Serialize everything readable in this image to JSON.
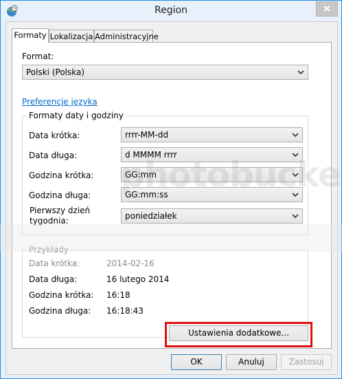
{
  "window": {
    "title": "Region"
  },
  "tabs": [
    {
      "label": "Formaty"
    },
    {
      "label": "Lokalizacja"
    },
    {
      "label": "Administracyjne"
    }
  ],
  "format": {
    "label": "Format:",
    "value": "Polski (Polska)"
  },
  "language_link": "Preferencje języka",
  "datetime_group": {
    "title": "Formaty daty i godziny",
    "rows": [
      {
        "label": "Data krótka:",
        "value": "rrrr-MM-dd"
      },
      {
        "label": "Data długa:",
        "value": "d MMMM rrrr"
      },
      {
        "label": "Godzina krótka:",
        "value": "GG:mm"
      },
      {
        "label": "Godzina długa:",
        "value": "GG:mm:ss"
      },
      {
        "label": "Pierwszy dzień tygodnia:",
        "label_line1": "Pierwszy dzień",
        "label_line2": "tygodnia:",
        "value": "poniedziałek"
      }
    ]
  },
  "examples_group": {
    "title": "Przykłady",
    "rows": [
      {
        "label": "Data krótka:",
        "value": "2014-02-16"
      },
      {
        "label": "Data długa:",
        "value": "16 lutego 2014"
      },
      {
        "label": "Godzina krótka:",
        "value": "16:18"
      },
      {
        "label": "Godzina długa:",
        "value": "16:18:43"
      }
    ]
  },
  "buttons": {
    "additional": "Ustawienia dodatkowe...",
    "ok": "OK",
    "cancel": "Anuluj",
    "apply": "Zastosuj"
  },
  "watermark": "photobucket",
  "colors": {
    "highlight": "#e01010",
    "link": "#0066cc",
    "frame": "#1c8be0"
  }
}
